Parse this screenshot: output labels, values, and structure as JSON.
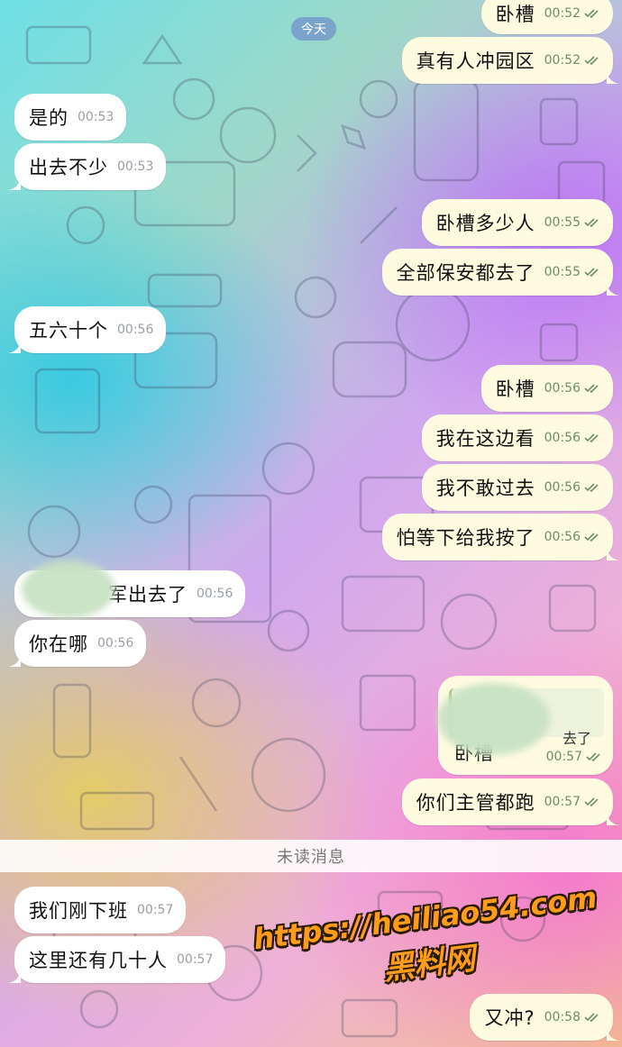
{
  "date_divider": "今天",
  "unread_label": "未读消息",
  "messages": [
    {
      "side": "out",
      "text": "卧槽",
      "time": "00:52"
    },
    {
      "side": "out",
      "text": "真有人冲园区",
      "time": "00:52"
    },
    {
      "side": "in",
      "text": "是的",
      "time": "00:53"
    },
    {
      "side": "in",
      "text": "出去不少",
      "time": "00:53"
    },
    {
      "side": "out",
      "text": "卧槽多少人",
      "time": "00:55"
    },
    {
      "side": "out",
      "text": "全部保安都去了",
      "time": "00:55"
    },
    {
      "side": "in",
      "text": "五六十个",
      "time": "00:56"
    },
    {
      "side": "out",
      "text": "卧槽",
      "time": "00:56"
    },
    {
      "side": "out",
      "text": "我在这边看",
      "time": "00:56"
    },
    {
      "side": "out",
      "text": "我不敢过去",
      "time": "00:56"
    },
    {
      "side": "out",
      "text": "怕等下给我按了",
      "time": "00:56"
    },
    {
      "side": "in",
      "text": "军出去了",
      "time": "00:56"
    },
    {
      "side": "in",
      "text": "你在哪",
      "time": "00:56"
    },
    {
      "side": "out",
      "text": "卧槽",
      "time": "00:57",
      "quote": "去了"
    },
    {
      "side": "out",
      "text": "你们主管都跑",
      "time": "00:57"
    },
    {
      "side": "in",
      "text": "我们刚下班",
      "time": "00:57"
    },
    {
      "side": "in",
      "text": "这里还有几十人",
      "time": "00:57"
    },
    {
      "side": "out",
      "text": "又冲?",
      "time": "00:58"
    }
  ],
  "watermark": {
    "url": "https://heiliao54.com",
    "name": "黑料网"
  }
}
